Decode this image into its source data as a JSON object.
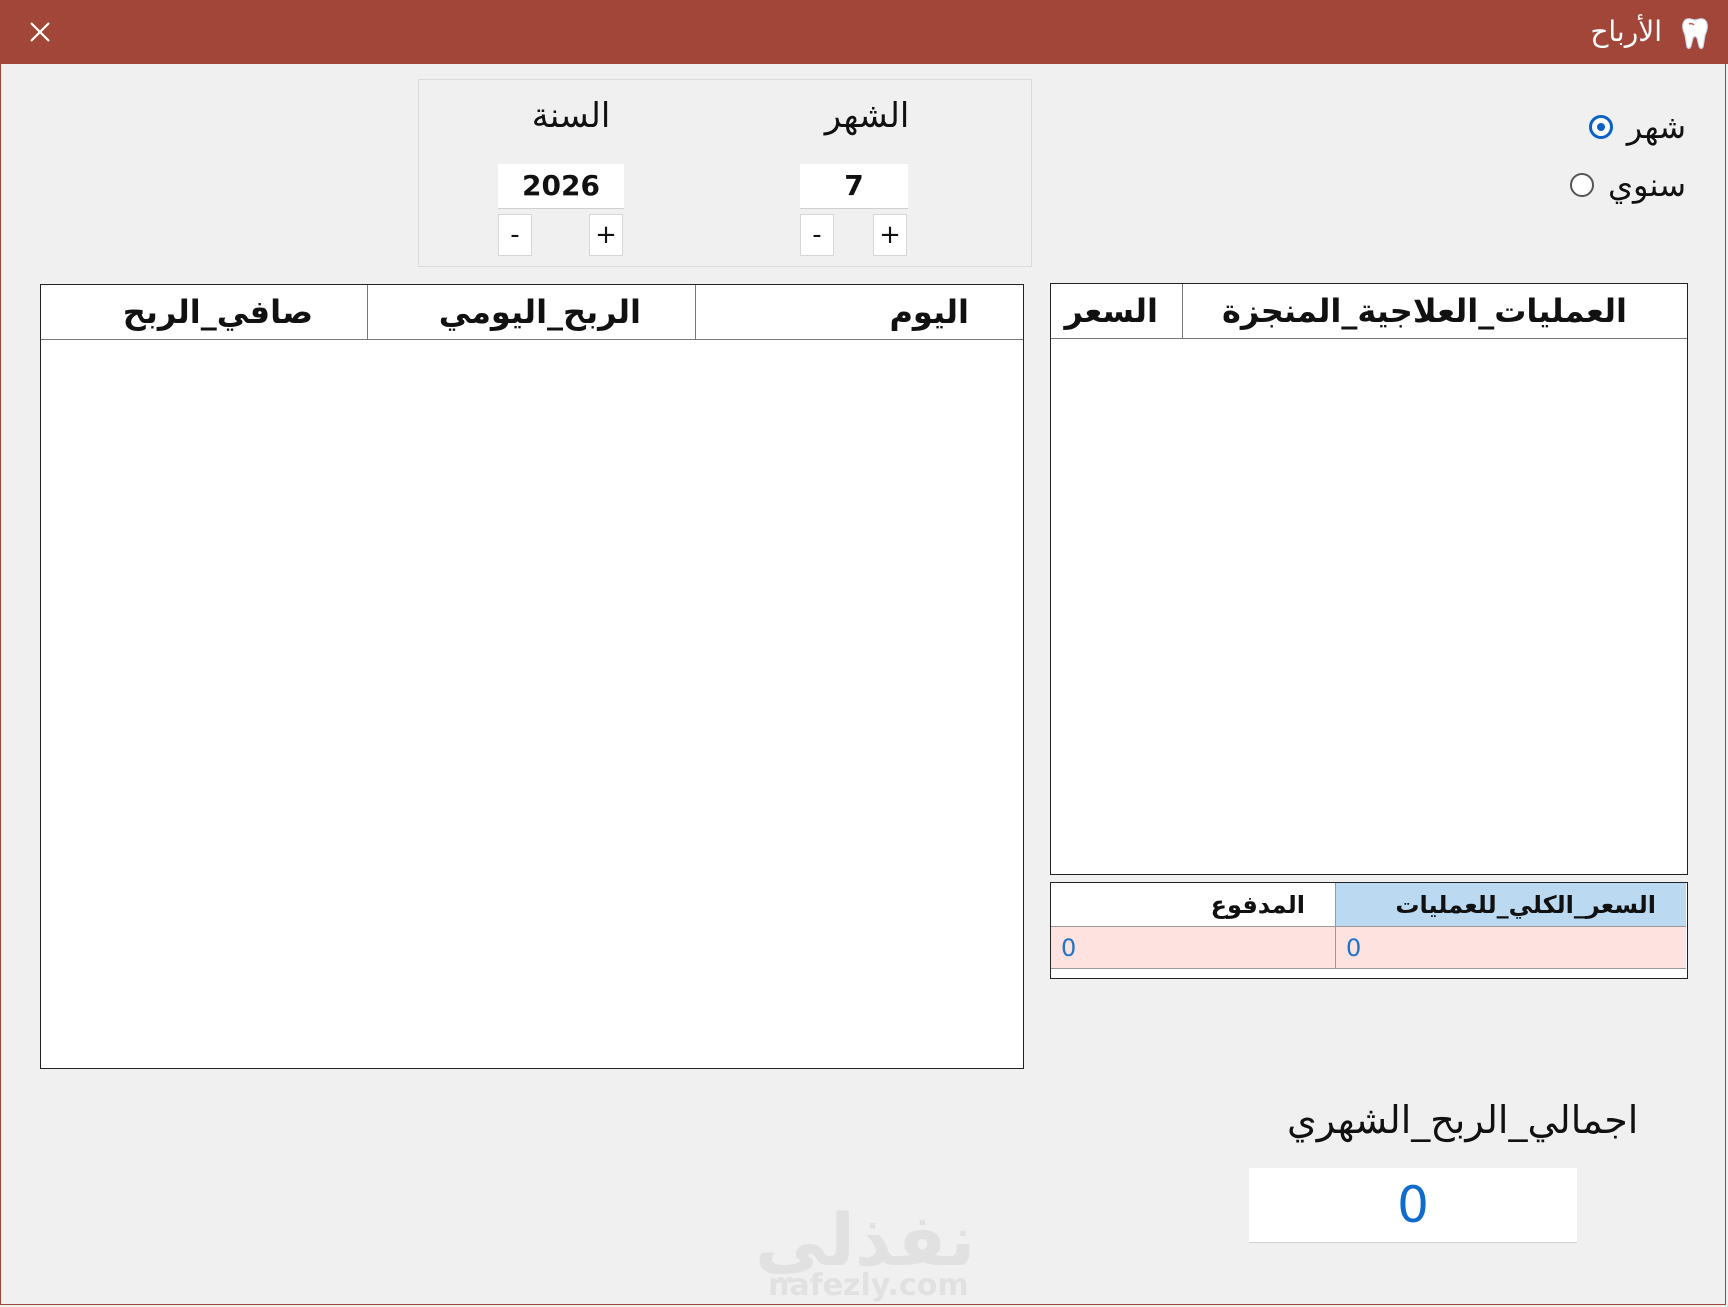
{
  "window": {
    "title": "الأرباح",
    "close_label": "✕",
    "app_icon": "tooth-icon",
    "accent_color": "#a14638"
  },
  "period_type": {
    "options": [
      {
        "label": "شهر",
        "checked": true
      },
      {
        "label": "سنوي",
        "checked": false
      }
    ]
  },
  "period": {
    "month_label": "الشهر",
    "month_value": "7",
    "year_label": "السنة",
    "year_value": "2026",
    "minus_label": "-",
    "plus_label": "+"
  },
  "profit_table": {
    "columns": [
      "اليوم",
      "الربح_اليومي",
      "صافي_الربح"
    ],
    "rows": []
  },
  "operations_table": {
    "columns": [
      "العمليات_العلاجية_المنجزة",
      "السعر"
    ],
    "rows": []
  },
  "totals": {
    "total_price_label": "السعر_الكلي_للعمليات",
    "paid_label": "المدفوع",
    "total_price_value": "0",
    "paid_value": "0",
    "header_highlight_color": "#bcd9f2",
    "value_bg_color": "#fde2e0"
  },
  "monthly_profit": {
    "label": "اجمالي_الربح_الشهري",
    "value": "0"
  },
  "watermark": {
    "arabic": "نفذلي",
    "latin": "nafezly.com"
  }
}
